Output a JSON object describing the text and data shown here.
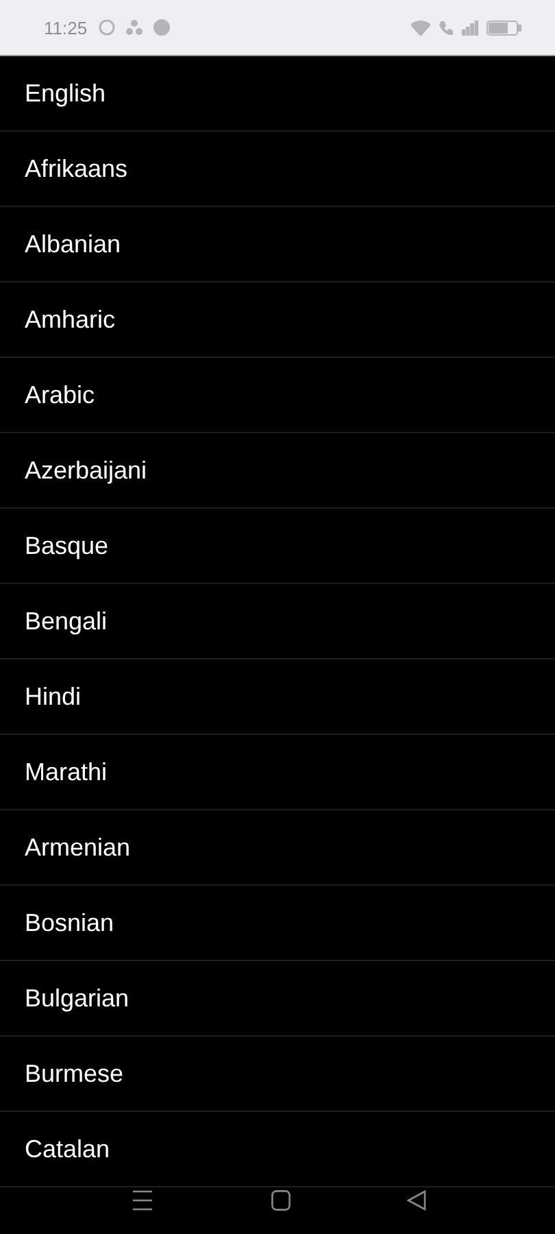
{
  "status_bar": {
    "time": "11:25"
  },
  "languages": [
    "English",
    "Afrikaans",
    "Albanian",
    "Amharic",
    "Arabic",
    "Azerbaijani",
    "Basque",
    "Bengali",
    "Hindi",
    "Marathi",
    "Armenian",
    "Bosnian",
    "Bulgarian",
    "Burmese",
    "Catalan"
  ]
}
